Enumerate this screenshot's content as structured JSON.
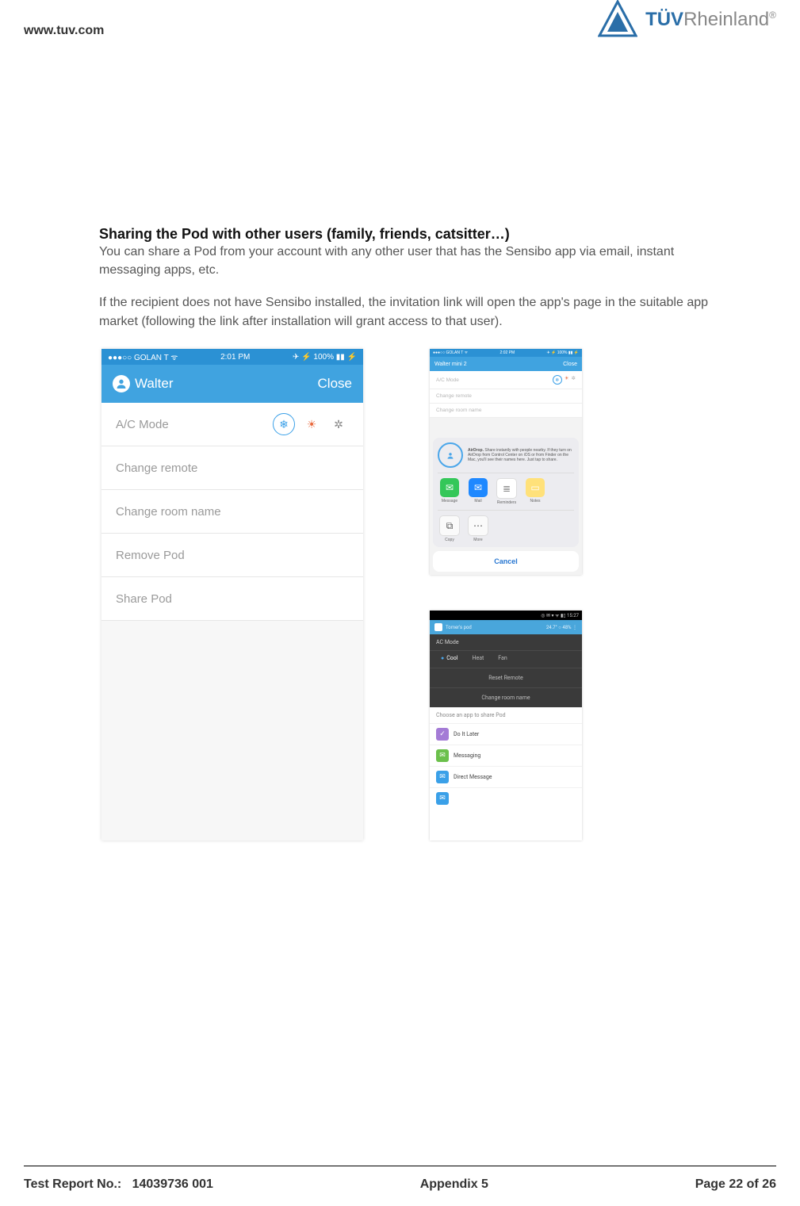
{
  "header": {
    "url": "www.tuv.com",
    "brand_bold": "TÜV",
    "brand_light": "Rheinland",
    "brand_r": "®"
  },
  "section": {
    "title": "Sharing the Pod with other users (family, friends, catsitter…)",
    "p1": "You can share a Pod from your account with any other user that has the Sensibo app via email, instant messaging apps, etc.",
    "p2": "If the recipient does not have Sensibo installed, the invitation link will open the app's page in the suitable app market (following the link after installation will grant access to that user)."
  },
  "phone1": {
    "status": {
      "carrier": "●●●○○ GOLAN T ᯤ",
      "time": "2:01 PM",
      "right": "✈ ⚡ 100% ▮▮ ⚡"
    },
    "nav": {
      "name": "Walter",
      "close": "Close"
    },
    "rows": {
      "ac_mode": "A/C Mode",
      "change_remote": "Change remote",
      "change_room": "Change room name",
      "remove_pod": "Remove Pod",
      "share_pod": "Share Pod"
    },
    "mode_icons": {
      "cool": "❄",
      "heat": "☀",
      "fan": "✲"
    }
  },
  "phone2": {
    "status": {
      "carrier": "●●●○○ GOLAN T ᯤ",
      "time": "2:02 PM",
      "right": "✈ ⚡ 100% ▮▮ ⚡"
    },
    "nav": {
      "name": "Walter mini 2",
      "close": "Close"
    },
    "dim": {
      "ac_mode": "A/C Mode",
      "change_remote": "Change remote",
      "change_room": "Change room name"
    },
    "airdrop": {
      "title": "AirDrop.",
      "text": " Share instantly with people nearby. If they turn on AirDrop from Control Center on iOS or from Finder on the Mac, you'll see their names here. Just tap to share."
    },
    "apps": [
      {
        "label": "Message",
        "color": "#34c759",
        "glyph": "✉"
      },
      {
        "label": "Mail",
        "color": "#1e88ff",
        "glyph": "✉"
      },
      {
        "label": "Reminders",
        "color": "#ffffff",
        "glyph": "≣"
      },
      {
        "label": "Notes",
        "color": "#ffe17a",
        "glyph": "▭"
      }
    ],
    "actions": [
      {
        "label": "Copy",
        "glyph": "⧉"
      },
      {
        "label": "More",
        "glyph": "⋯"
      }
    ],
    "cancel": "Cancel"
  },
  "phone3": {
    "status": {
      "icons": "◎ ✉ ▾ ᯤ ▮▯ 15:27"
    },
    "top": {
      "name": "Tomer's pod",
      "right": "24.7° ○ 48% ⋮"
    },
    "ac_mode": "AC Mode",
    "modes": {
      "cool": "Cool",
      "heat": "Heat",
      "fan": "Fan"
    },
    "reset": "Reset Remote",
    "change_room": "Change room name",
    "choose": "Choose an app to share Pod",
    "options": [
      {
        "label": "Do It Later",
        "color": "#a47bd6",
        "glyph": "✓"
      },
      {
        "label": "Messaging",
        "color": "#6bc04b",
        "glyph": "✉"
      },
      {
        "label": "Direct Message",
        "color": "#3aa0e8",
        "glyph": "✉"
      },
      {
        "label": "",
        "color": "#3aa0e8",
        "glyph": "✉"
      }
    ]
  },
  "footer": {
    "left_label": "Test Report No.:",
    "left_value": "14039736 001",
    "center": "Appendix 5",
    "right": "Page 22 of 26"
  }
}
